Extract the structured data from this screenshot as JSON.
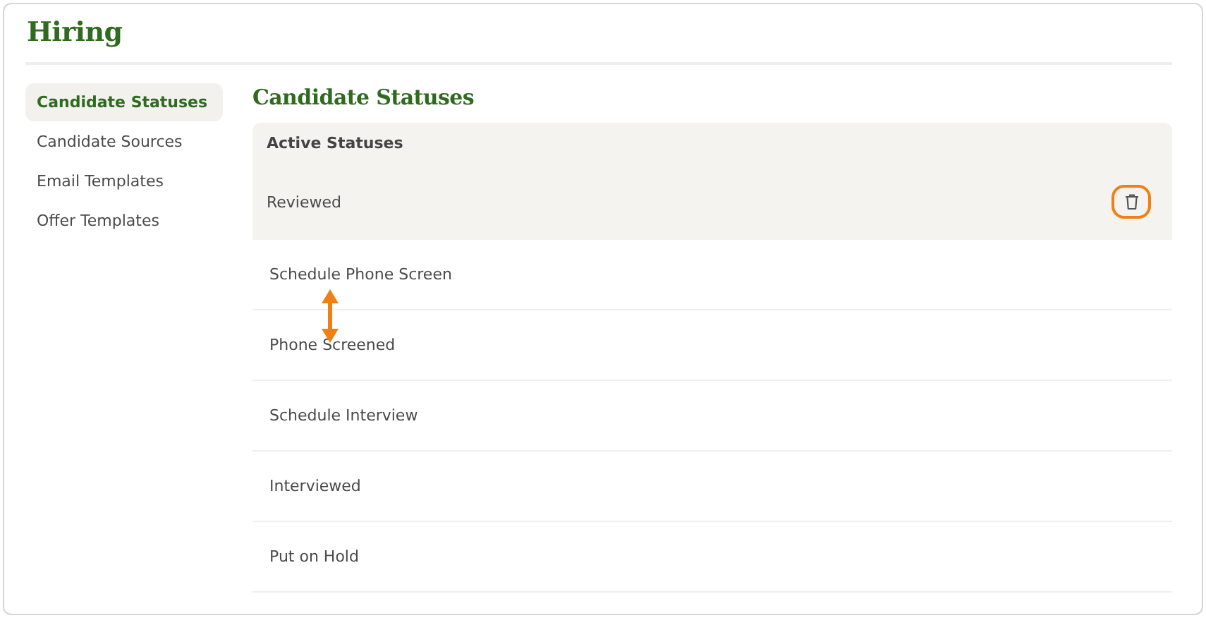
{
  "title": "Hiring",
  "sidebar": {
    "items": [
      {
        "label": "Candidate Statuses",
        "selected": true
      },
      {
        "label": "Candidate Sources",
        "selected": false
      },
      {
        "label": "Email Templates",
        "selected": false
      },
      {
        "label": "Offer Templates",
        "selected": false
      }
    ]
  },
  "content": {
    "heading": "Candidate Statuses",
    "section": "Active Statuses",
    "statuses": [
      {
        "label": "Reviewed",
        "hovered": true,
        "delete_ring": true
      },
      {
        "label": "Schedule Phone Screen",
        "hovered": false
      },
      {
        "label": "Phone Screened",
        "hovered": false
      },
      {
        "label": "Schedule Interview",
        "hovered": false
      },
      {
        "label": "Interviewed",
        "hovered": false
      },
      {
        "label": "Put on Hold",
        "hovered": false
      }
    ]
  },
  "drag_arrow": true
}
